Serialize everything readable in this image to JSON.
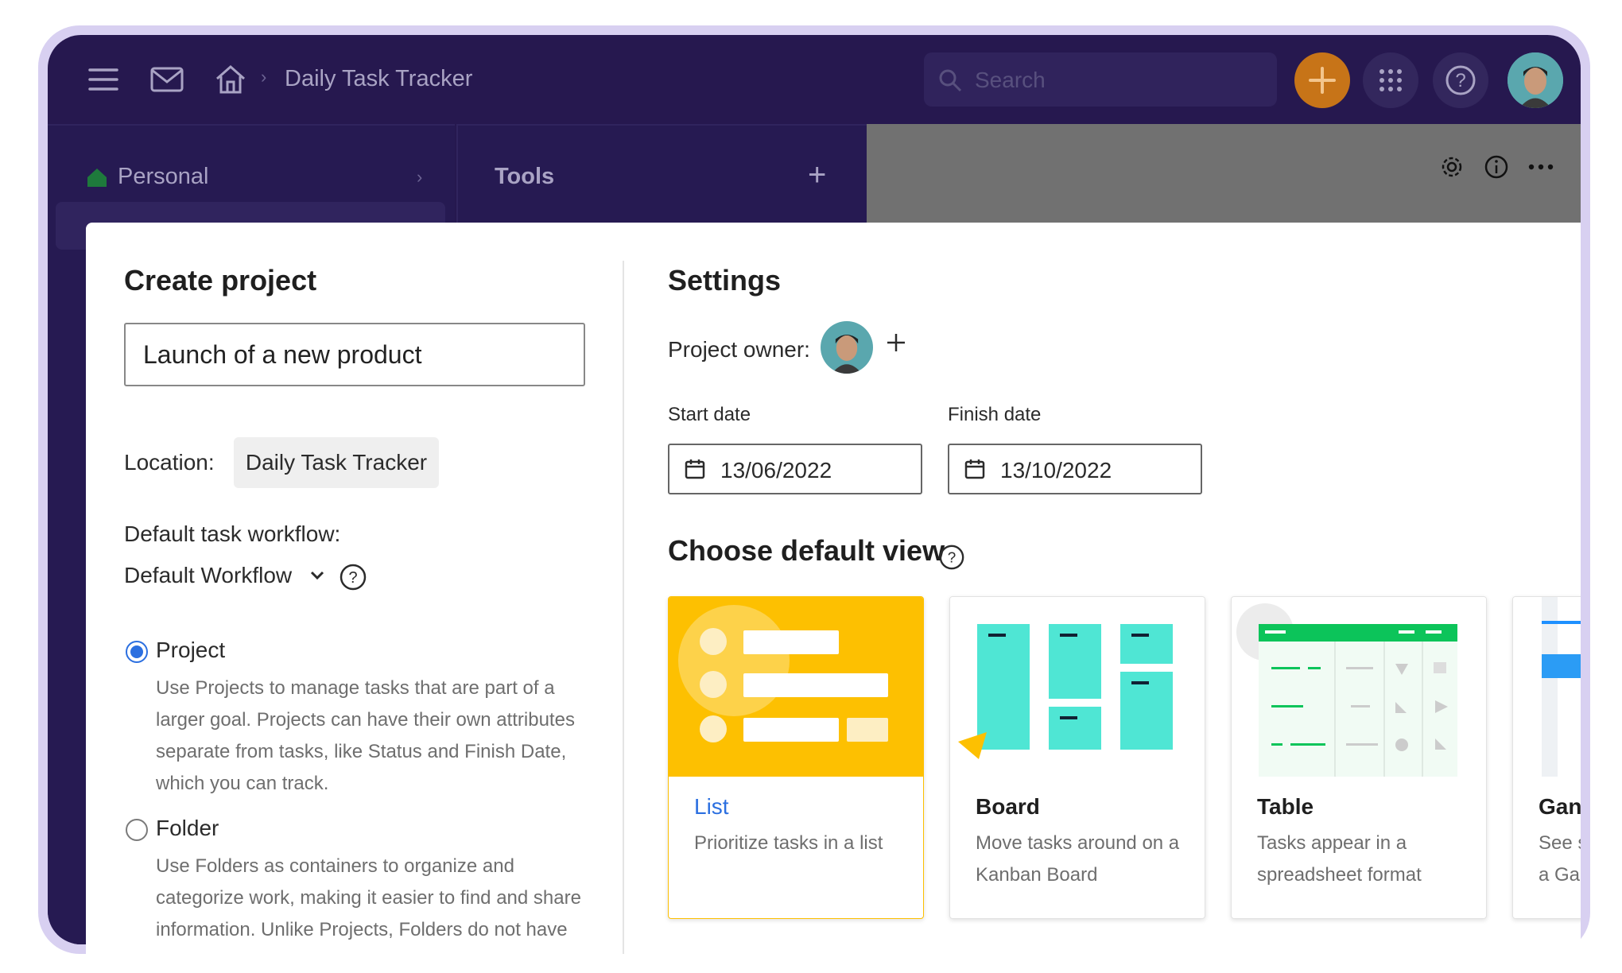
{
  "breadcrumb": {
    "current": "Daily Task Tracker"
  },
  "search": {
    "placeholder": "Search"
  },
  "sidebar": {
    "personal_label": "Personal"
  },
  "tools": {
    "title": "Tools"
  },
  "modal": {
    "left": {
      "title": "Create project",
      "name_value": "Launch of a new product",
      "location_label": "Location:",
      "location_value": "Daily Task Tracker",
      "workflow_label": "Default task workflow:",
      "workflow_value": "Default Workflow",
      "options": [
        {
          "label": "Project",
          "selected": true,
          "description": "Use Projects to manage tasks that are part of a larger goal. Projects can have their own attributes separate from tasks, like Status and Finish Date, which you can track."
        },
        {
          "label": "Folder",
          "selected": false,
          "description": "Use Folders as containers to organize and categorize work, making it easier to find and share information. Unlike Projects, Folders do not have"
        }
      ]
    },
    "right": {
      "title": "Settings",
      "owner_label": "Project owner:",
      "start_label": "Start date",
      "start_value": "13/06/2022",
      "finish_label": "Finish date",
      "finish_value": "13/10/2022",
      "view_title": "Choose default view",
      "views": [
        {
          "title": "List",
          "desc": "Prioritize tasks in a list",
          "selected": true
        },
        {
          "title": "Board",
          "desc": "Move tasks around on a Kanban Board",
          "selected": false
        },
        {
          "title": "Table",
          "desc": "Tasks appear in a spreadsheet format",
          "selected": false
        },
        {
          "title": "Gant",
          "desc": "See sc a Gan",
          "selected": false
        }
      ]
    }
  },
  "colors": {
    "accent": "#2b6fe0",
    "top_bar": "#26184f",
    "plus_button": "#c77418",
    "list_thumb": "#fdc001",
    "board_thumb": "#4fe6d4",
    "table_header": "#0cc45a"
  },
  "icons": [
    "menu-icon",
    "mail-icon",
    "home-icon",
    "search-icon",
    "plus-icon",
    "apps-grid-icon",
    "help-icon",
    "gear-icon",
    "info-icon",
    "more-icon",
    "calendar-icon",
    "chevron-down-icon"
  ]
}
